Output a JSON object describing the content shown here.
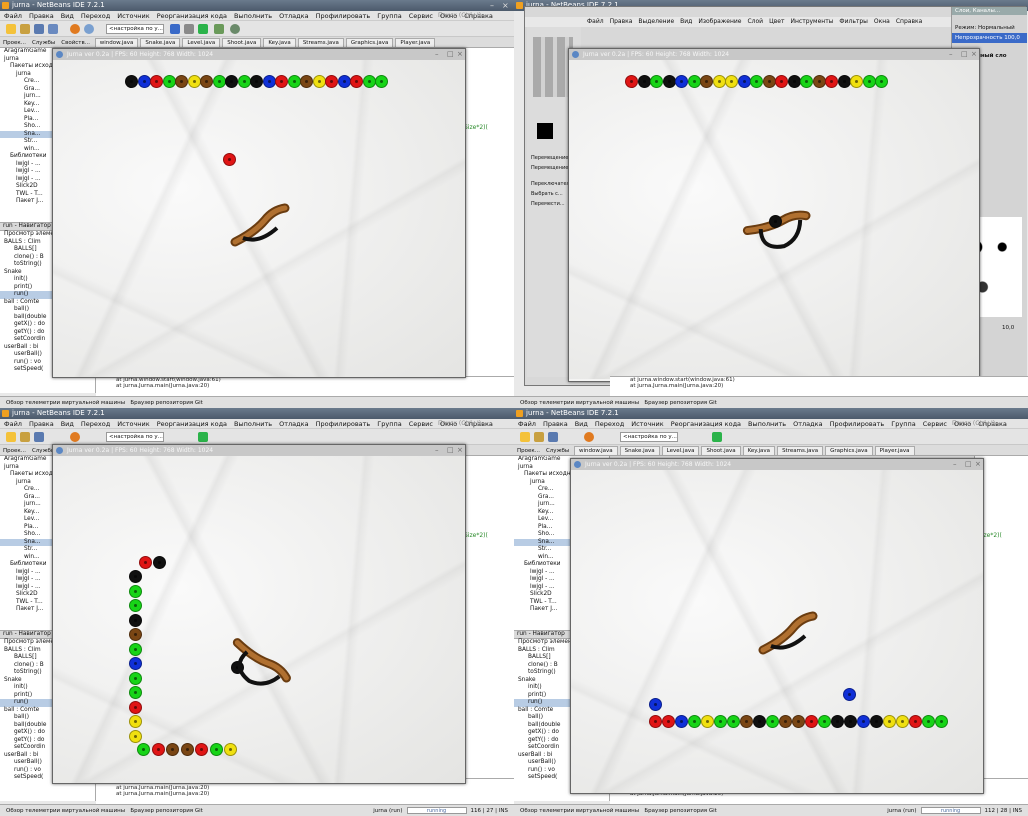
{
  "ide": {
    "title": "jurna - NetBeans IDE 7.2.1",
    "menu": [
      "Файл",
      "Правка",
      "Вид",
      "Переход",
      "Источник",
      "Реорганизация кода",
      "Выполнить",
      "Отладка",
      "Профилировать",
      "Группа",
      "Сервис",
      "Окно",
      "Справка"
    ],
    "search_placeholder": "Поиск (Ctrl+I)",
    "config_combo": "<настройка по у...",
    "left_tabs": [
      "Проек...",
      "Службы",
      "Свойств..."
    ],
    "editor_tabs": [
      "window.java",
      "Snake.java",
      "Level.java",
      "Shoot.java",
      "Key.java",
      "Streams.java",
      "Graphics.java",
      "Player.java"
    ],
    "tree": [
      "AragramGame",
      "jurna",
      "Пакеты исходных файлов",
      "jurna",
      "Cre...",
      "Gra...",
      "jurn...",
      "Key...",
      "Lev...",
      "Pla...",
      "Sho...",
      "Sna...",
      "Str...",
      "win...",
      "Библиотеки",
      "lwjgl - ...",
      "lwjgl - ...",
      "lwjgl - ...",
      "Slick2D",
      "TWL - T...",
      "Пакет J..."
    ],
    "nav_title": "run - Навигатор",
    "nav_subtitle": "Просмотр элементов",
    "nav_items": [
      "BALLS : Clim",
      "BALLS[]",
      "clone() : B",
      "toString()",
      "Snake",
      "init()",
      "print()",
      "run()",
      "ball : Comte",
      "ball()",
      "ball(double",
      "getX() : do",
      "getY() : do",
      "setCoordin",
      "userBall : bi",
      "userBall()",
      "run() : vo",
      "setSpeed("
    ],
    "code_fragment": "Size*2)(",
    "output_lines": [
      "at jurna.window.start(window.java:61)",
      "at jurna.Jurna.main(Jurna.java:20)",
      "at jurna.Jurna.main(Jurna.java:20)"
    ],
    "status_left": "Обзор телеметрии виртуальной машины",
    "status_mid": "Браузер репозитория Git",
    "status_app": "jurna (run)",
    "status_running": "running",
    "status_pos_q3": "116 | 27",
    "status_mode": "INS",
    "status_pos_q4": "112 | 28"
  },
  "game": {
    "title": "Jurna ver 0.2a | FPS: 60 Height: 768 Width: 1024"
  },
  "gimp": {
    "title": "jurna - NetBeans IDE 7.2.1",
    "menu": [
      "Файл",
      "Правка",
      "Выделение",
      "Вид",
      "Изображение",
      "Слой",
      "Цвет",
      "Инструменты",
      "Фильтры",
      "Окна",
      "Справка"
    ],
    "panel_title": "Слои, Каналы...",
    "mode_label": "Режим: Нормальный",
    "opacity_label": "Непрозрачность",
    "opacity_value": "100,0",
    "move_label": "Перемещение",
    "move_sub": "Перемещение:",
    "toggle_label": "Переключатель и...",
    "opt_pick": "Выбрать с...",
    "opt_move": "Перемести...",
    "size_value": "10,0",
    "layer_hint": "Встроенный сло"
  },
  "colors": {
    "black": "#101010",
    "red": "#e01515",
    "blue": "#1030d8",
    "green": "#17d417",
    "brown": "#7a4614",
    "yellow": "#f0e010"
  }
}
